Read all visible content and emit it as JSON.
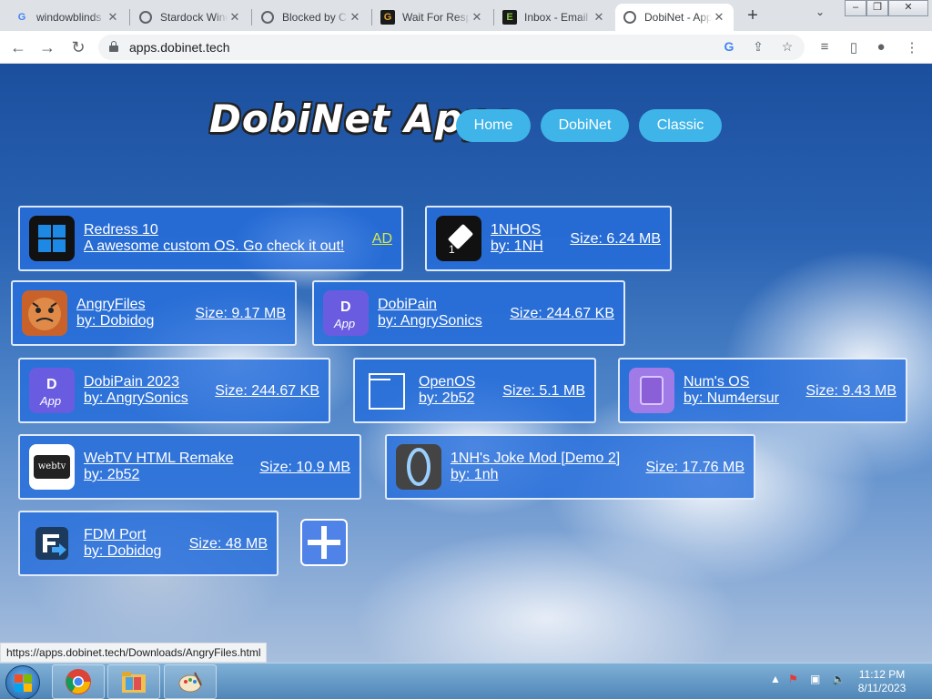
{
  "browser": {
    "tabs": [
      {
        "title": "windowblinds",
        "favicon": "google-g-icon"
      },
      {
        "title": "Stardock WindowBlinds",
        "favicon": "globe-icon"
      },
      {
        "title": "Blocked by Chrome",
        "favicon": "globe-icon"
      },
      {
        "title": "Wait For Response",
        "favicon": "g-square-icon"
      },
      {
        "title": "Inbox - Email",
        "favicon": "e-square-icon"
      },
      {
        "title": "DobiNet - Apps",
        "favicon": "globe-icon",
        "active": true
      }
    ],
    "url": "apps.dobinet.tech"
  },
  "site": {
    "logo": "DobiNet Apps",
    "nav": [
      "Home",
      "DobiNet",
      "Classic"
    ]
  },
  "apps": [
    {
      "name": "Redress 10",
      "sub": "A awesome custom OS. Go check it out!",
      "tag": "AD",
      "icon": "windows-logo-icon"
    },
    {
      "name": "1NHOS",
      "sub": "by: 1NH",
      "size": "Size: 6.24 MB",
      "icon": "eraser-icon"
    },
    {
      "name": "AngryFiles",
      "sub": "by: Dobidog",
      "size": "Size: 9.17 MB",
      "icon": "angry-dog-icon"
    },
    {
      "name": "DobiPain",
      "sub": "by: AngrySonics",
      "size": "Size: 244.67 KB",
      "icon": "dobipain-app-icon"
    },
    {
      "name": "DobiPain 2023",
      "sub": "by: AngrySonics",
      "size": "Size: 244.67 KB",
      "icon": "dobipain-app-icon"
    },
    {
      "name": "OpenOS",
      "sub": "by: 2b52",
      "size": "Size: 5.1 MB",
      "icon": "window-frame-icon"
    },
    {
      "name": "Num's OS",
      "sub": "by: Num4ersur",
      "size": "Size: 9.43 MB",
      "icon": "purple-tablet-icon"
    },
    {
      "name": "WebTV HTML Remake",
      "sub": "by: 2b52",
      "size": "Size: 10.9 MB",
      "icon": "webtv-logo-icon",
      "icon_text": "webtv"
    },
    {
      "name": "1NH's Joke Mod [Demo 2]",
      "sub": "by: 1nh",
      "size": "Size: 17.76 MB",
      "icon": "portal-ring-icon"
    },
    {
      "name": "FDM Port",
      "sub": "by: Dobidog",
      "size": "Size: 48 MB",
      "icon": "fdm-logo-icon"
    }
  ],
  "status_url": "https://apps.dobinet.tech/Downloads/AngryFiles.html",
  "taskbar": {
    "time": "11:12 PM",
    "date": "8/11/2023"
  }
}
